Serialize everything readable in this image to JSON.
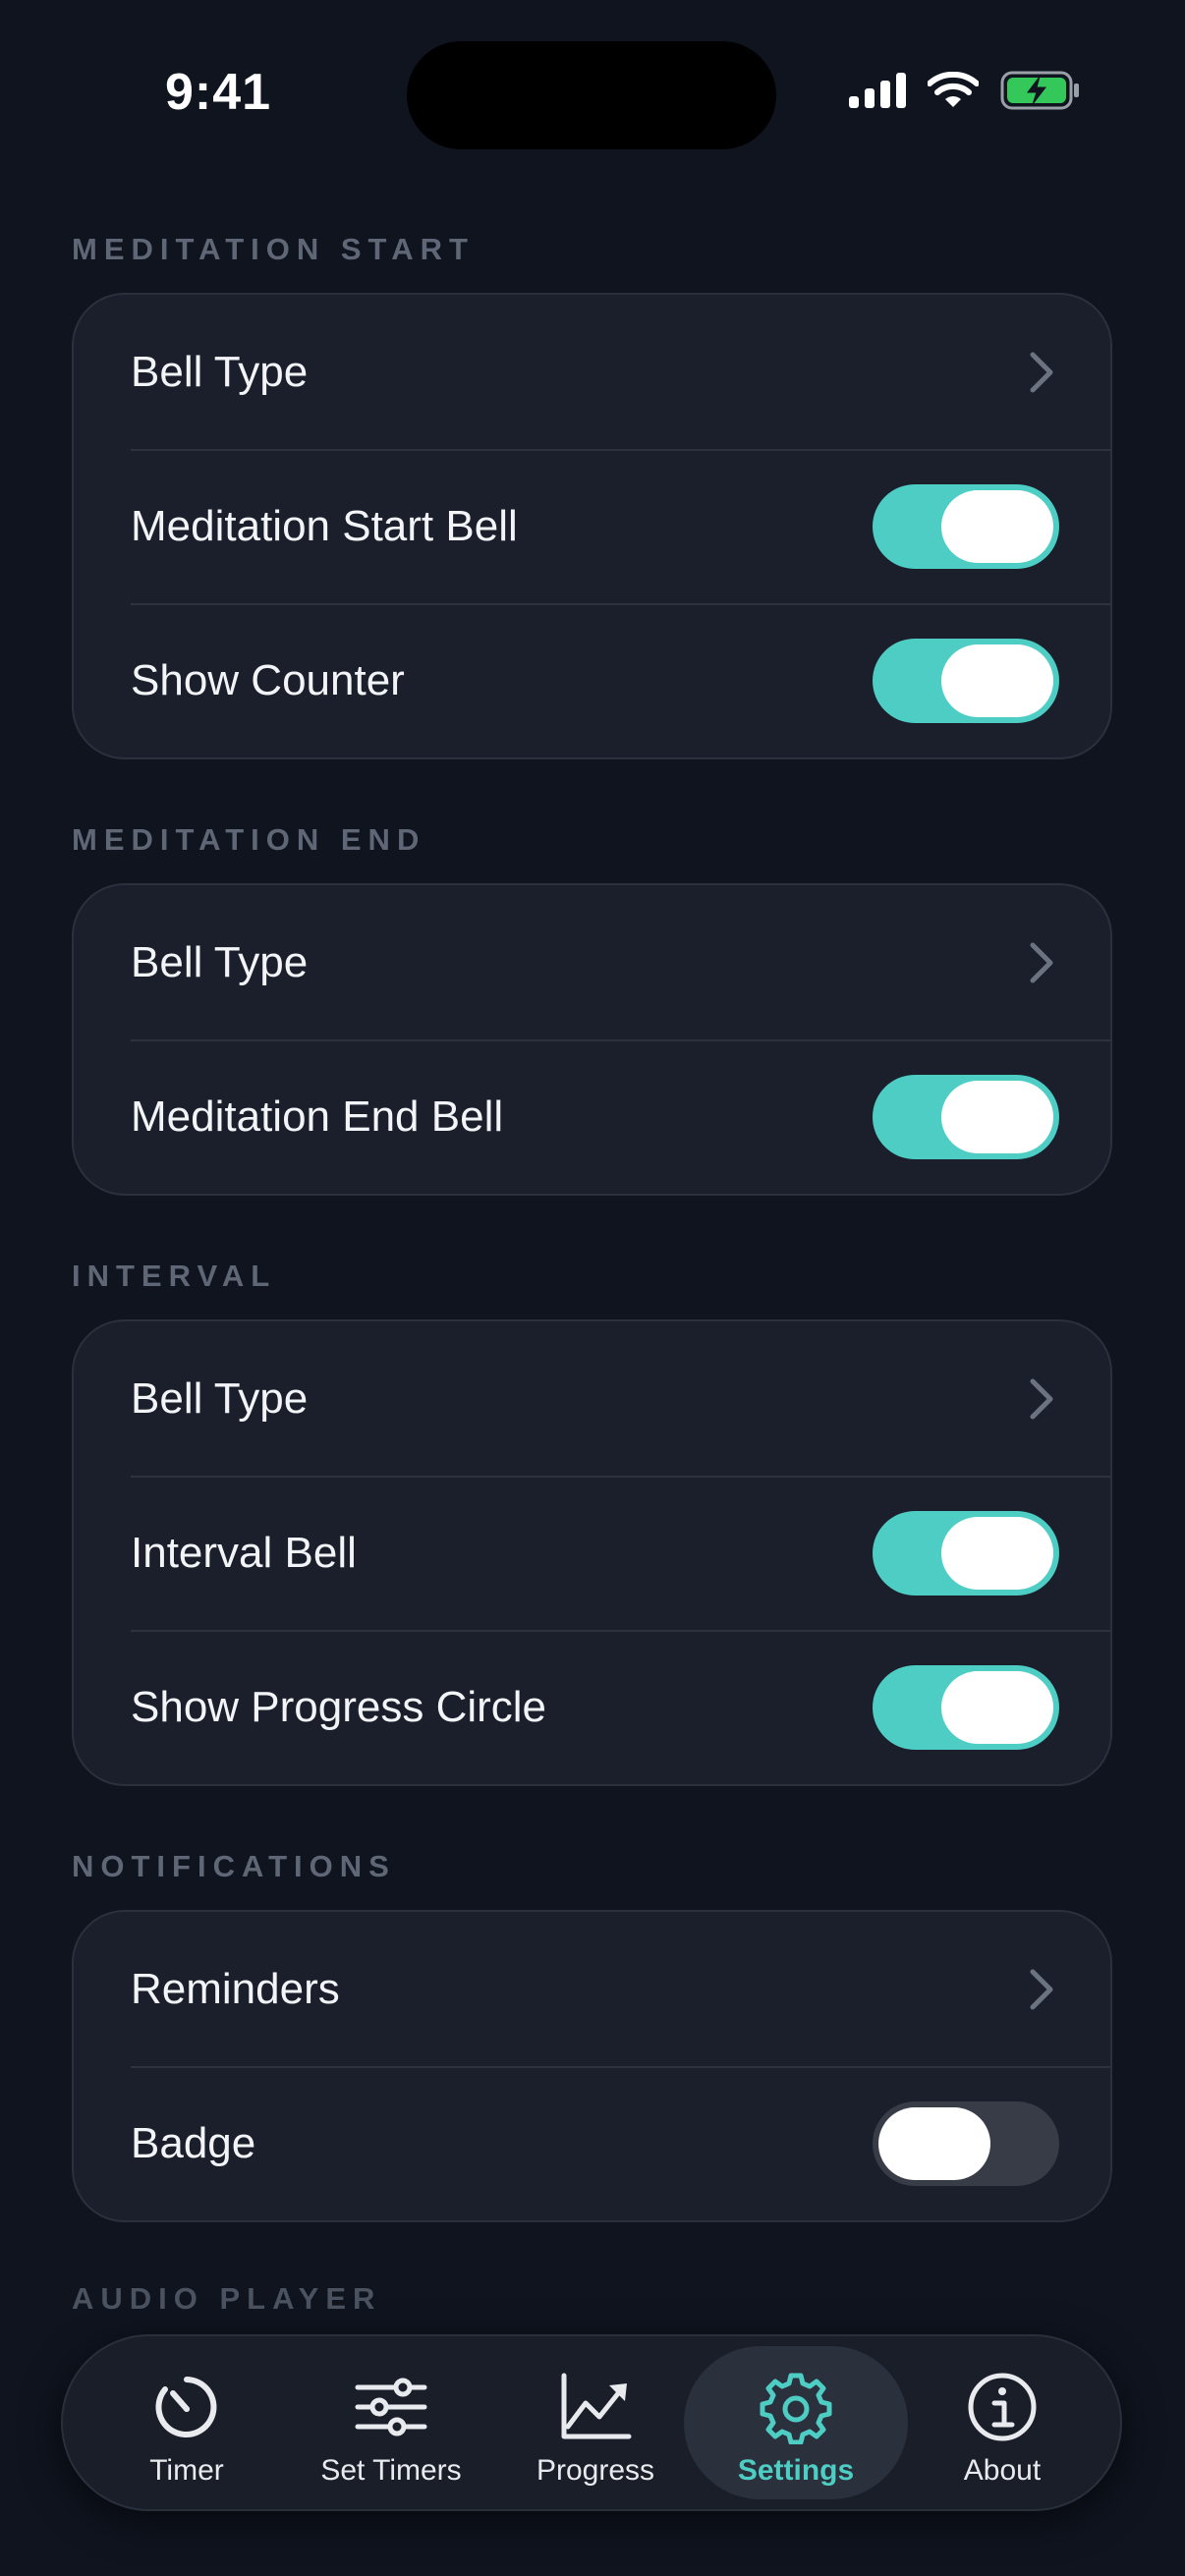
{
  "status_bar": {
    "time": "9:41"
  },
  "sections": [
    {
      "header": "MEDITATION START",
      "rows": [
        {
          "label": "Bell Type",
          "kind": "chevron"
        },
        {
          "label": "Meditation Start Bell",
          "kind": "toggle",
          "on": true
        },
        {
          "label": "Show Counter",
          "kind": "toggle",
          "on": true
        }
      ]
    },
    {
      "header": "MEDITATION END",
      "rows": [
        {
          "label": "Bell Type",
          "kind": "chevron"
        },
        {
          "label": "Meditation End Bell",
          "kind": "toggle",
          "on": true
        }
      ]
    },
    {
      "header": "INTERVAL",
      "rows": [
        {
          "label": "Bell Type",
          "kind": "chevron"
        },
        {
          "label": "Interval Bell",
          "kind": "toggle",
          "on": true
        },
        {
          "label": "Show Progress Circle",
          "kind": "toggle",
          "on": true
        }
      ]
    },
    {
      "header": "NOTIFICATIONS",
      "rows": [
        {
          "label": "Reminders",
          "kind": "chevron"
        },
        {
          "label": "Badge",
          "kind": "toggle",
          "on": false
        }
      ]
    }
  ],
  "peek": {
    "header": "AUDIO PLAYER"
  },
  "tab_bar": {
    "active": "Settings",
    "tabs": [
      {
        "label": "Timer",
        "icon": "timer-icon"
      },
      {
        "label": "Set Timers",
        "icon": "sliders-icon"
      },
      {
        "label": "Progress",
        "icon": "chart-icon"
      },
      {
        "label": "Settings",
        "icon": "gear-icon"
      },
      {
        "label": "About",
        "icon": "info-icon"
      }
    ]
  },
  "colors": {
    "background": "#0f141f",
    "card": "#1a1f2b",
    "accent": "#4ecdc4",
    "section_header": "#5f6776",
    "toggle_off": "#373c47"
  }
}
